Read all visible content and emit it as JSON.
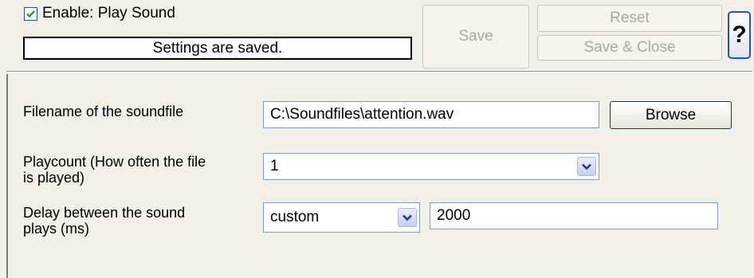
{
  "header": {
    "enable_label": "Enable: Play Sound",
    "enable_checked": true,
    "status_text": "Settings are saved.",
    "save_label": "Save",
    "reset_label": "Reset",
    "save_close_label": "Save & Close",
    "help_label": "?"
  },
  "form": {
    "filename_label": "Filename of the soundfile",
    "filename_value": "C:\\Soundfiles\\attention.wav",
    "browse_label": "Browse",
    "playcount_label_line1": "Playcount (How often the file",
    "playcount_label_line2": "is played)",
    "playcount_value": "1",
    "delay_label_line1": "Delay between the sound",
    "delay_label_line2": "plays (ms)",
    "delay_mode_value": "custom",
    "delay_ms_value": "2000"
  },
  "icons": {
    "checkmark": "checkmark-icon",
    "dropdown": "chevron-down-icon"
  },
  "colors": {
    "background": "#f0efe8",
    "checkmark": "#21a121",
    "help_border": "#1d56c4",
    "field_border": "#7f9db9"
  }
}
